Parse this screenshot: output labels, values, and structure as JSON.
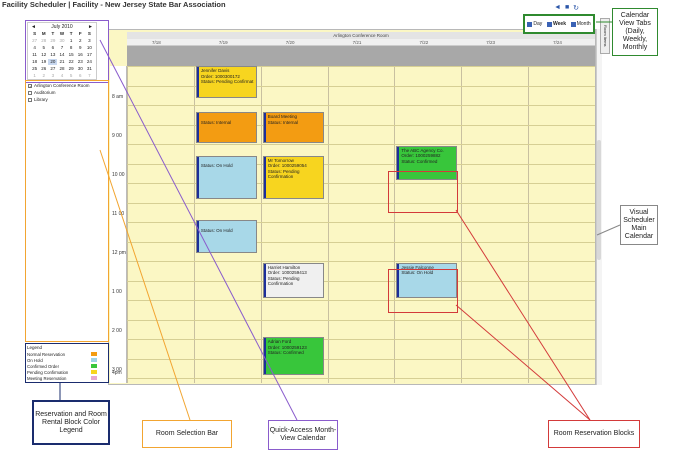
{
  "page_title": "Facility Scheduler | Facility - New Jersey State Bar Association",
  "mini_calendar": {
    "month_label": "July 2010",
    "prev_label": "◄",
    "next_label": "►",
    "dow": [
      "S",
      "M",
      "T",
      "W",
      "T",
      "F",
      "S"
    ],
    "weeks": [
      [
        "27",
        "28",
        "29",
        "30",
        "1",
        "2",
        "3"
      ],
      [
        "4",
        "5",
        "6",
        "7",
        "8",
        "9",
        "10"
      ],
      [
        "11",
        "12",
        "13",
        "14",
        "15",
        "16",
        "17"
      ],
      [
        "18",
        "19",
        "20",
        "21",
        "22",
        "23",
        "24"
      ],
      [
        "25",
        "26",
        "27",
        "28",
        "29",
        "30",
        "31"
      ],
      [
        "1",
        "2",
        "3",
        "4",
        "5",
        "6",
        "7"
      ]
    ]
  },
  "rooms": [
    {
      "label": "Arlington Conference Room",
      "checked": true
    },
    {
      "label": "Auditorium",
      "checked": false
    },
    {
      "label": "Library",
      "checked": false
    }
  ],
  "legend": {
    "title": "Legend",
    "items": [
      {
        "label": "Normal Reservation",
        "color": "#f39c12"
      },
      {
        "label": "On Hold",
        "color": "#9fd3e6"
      },
      {
        "label": "Confirmed Order",
        "color": "#38c63b"
      },
      {
        "label": "Pending Confirmation",
        "color": "#f7d51f"
      },
      {
        "label": "Meeting Reservation",
        "color": "#e7a8d2"
      }
    ]
  },
  "calendar": {
    "room_name": "Arlington Conference Room",
    "days": [
      "7/18",
      "7/19",
      "7/20",
      "7/21",
      "7/22",
      "7/23",
      "7/24"
    ],
    "times": [
      "8 am",
      "9 00",
      "10 00",
      "11 00",
      "12 pm",
      "1 00",
      "2 00",
      "3 00",
      "4pm"
    ],
    "events": [
      {
        "day": 1,
        "start": 0,
        "end": 0.82,
        "color": "#f7d51f",
        "lines": [
          "Jennifer Davis",
          "Order: 1000300172",
          "Status: Pending Confirmat"
        ]
      },
      {
        "day": 1,
        "start": 1.18,
        "end": 1.98,
        "color": "#f39c12",
        "lines": [
          "",
          "Status: Internal"
        ]
      },
      {
        "day": 2,
        "start": 1.18,
        "end": 1.98,
        "color": "#f39c12",
        "lines": [
          "Board Meeting",
          "Status: Internal"
        ]
      },
      {
        "day": 1,
        "start": 2.3,
        "end": 3.4,
        "color": "#a8d8e8",
        "lines": [
          "",
          "Status: On Hold"
        ]
      },
      {
        "day": 2,
        "start": 2.3,
        "end": 3.4,
        "color": "#f7d51f",
        "lines": [
          "Mr Tomorrow",
          "Order: 1000259054",
          "Status: Pending",
          "Confirmation"
        ]
      },
      {
        "day": 4,
        "start": 2.05,
        "end": 2.92,
        "color": "#38c63b",
        "lines": [
          "The ABC Agency Co.",
          "Order: 1000259882",
          "Status: Confirmed"
        ]
      },
      {
        "day": 1,
        "start": 3.95,
        "end": 4.8,
        "color": "#a8d8e8",
        "lines": [
          "",
          "Status: On Hold"
        ]
      },
      {
        "day": 2,
        "start": 5.05,
        "end": 5.95,
        "color": "#f0f0f0",
        "lines": [
          "Harriet Hamilton",
          "Order: 1000259413",
          "Status: Pending",
          "Confirmation"
        ]
      },
      {
        "day": 4,
        "start": 5.05,
        "end": 5.95,
        "color": "#a8d8e8",
        "lines": [
          "Jessie Falconne",
          "Status: On Hold"
        ]
      },
      {
        "day": 2,
        "start": 6.95,
        "end": 7.92,
        "color": "#38c63b",
        "lines": [
          "Adrian Ford",
          "Order: 1000259123",
          "Status: Confirmed"
        ]
      }
    ]
  },
  "view_tabs": [
    {
      "label": "Day",
      "active": false
    },
    {
      "label": "Week",
      "active": true
    },
    {
      "label": "Month",
      "active": false
    }
  ],
  "side_tab_label": "Room Items",
  "annotations": {
    "view_tabs": "Calendar View Tabs (Daily, Weekly, Monthly",
    "main_calendar": "Visual Scheduler Main Calendar",
    "legend": "Reservation and Room Rental Block Color Legend",
    "room_bar": "Room Selection Bar",
    "month_view": "Quick-Access Month-View Calendar",
    "reservation_blocks": "Room Reservation Blocks"
  },
  "colors": {
    "calendar_bg": "#fbf7c4",
    "annotation_purple": "#8a5ccc",
    "annotation_orange": "#f2a531",
    "annotation_red": "#d33a3a",
    "annotation_green": "#2f8a2f",
    "annotation_navy": "#1a2c6e"
  }
}
